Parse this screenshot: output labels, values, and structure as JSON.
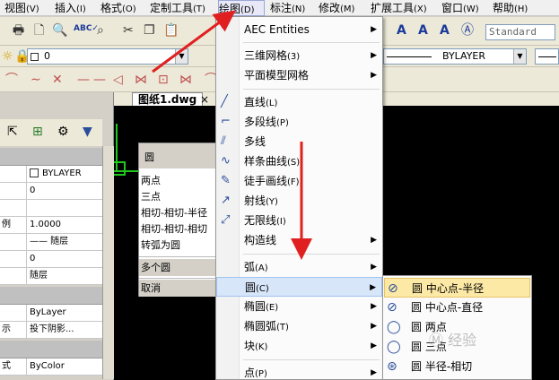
{
  "menubar": {
    "items": [
      {
        "label": "视图",
        "accel": "(V)"
      },
      {
        "label": "插入",
        "accel": "(I)"
      },
      {
        "label": "格式",
        "accel": "(O)"
      },
      {
        "label": "定制工具",
        "accel": "(T)"
      },
      {
        "label": "绘图",
        "accel": "(D)"
      },
      {
        "label": "标注",
        "accel": "(N)"
      },
      {
        "label": "修改",
        "accel": "(M)"
      },
      {
        "label": "扩展工具",
        "accel": "(X)"
      },
      {
        "label": "窗口",
        "accel": "(W)"
      },
      {
        "label": "帮助",
        "accel": "(H)"
      }
    ]
  },
  "toolbar": {
    "layer_value": "0",
    "linetype_value": "BYLAYER",
    "textstyle_value": "Standard"
  },
  "drawing_tab": {
    "filename": "图纸1.dwg",
    "close": "×"
  },
  "properties": {
    "rows": [
      {
        "label": "",
        "value": "BYLAYER"
      },
      {
        "label": "",
        "value": "0"
      },
      {
        "label": "",
        "value": ""
      },
      {
        "label": "例",
        "value": "1.0000"
      },
      {
        "label": "",
        "value": "—— 随层"
      },
      {
        "label": "",
        "value": "0"
      },
      {
        "label": "",
        "value": "随层"
      },
      {
        "label": "",
        "value": "ByLayer"
      },
      {
        "label": "示",
        "value": "投下阴影..."
      },
      {
        "label": "式",
        "value": "ByColor"
      }
    ]
  },
  "circle_panel": {
    "title": "圆",
    "items": [
      "两点",
      "三点",
      "相切-相切-半径",
      "相切-相切-相切",
      "转弧为圆",
      "多个圆",
      "取消"
    ]
  },
  "draw_menu": {
    "items": [
      {
        "label": "AEC Entities",
        "accel": "",
        "submenu": true,
        "icon": ""
      },
      {
        "label": "三维网格",
        "accel": "(3)",
        "submenu": true,
        "icon": ""
      },
      {
        "label": "平面模型网格",
        "accel": "",
        "submenu": true,
        "icon": ""
      },
      {
        "label": "直线",
        "accel": "(L)",
        "submenu": false,
        "icon": "line-icon"
      },
      {
        "label": "多段线",
        "accel": "(P)",
        "submenu": false,
        "icon": "polyline-icon"
      },
      {
        "label": "多线",
        "accel": "",
        "submenu": false,
        "icon": "multiline-icon"
      },
      {
        "label": "样条曲线",
        "accel": "(S)",
        "submenu": false,
        "icon": "spline-icon"
      },
      {
        "label": "徒手画线",
        "accel": "(F)",
        "submenu": false,
        "icon": "freehand-icon"
      },
      {
        "label": "射线",
        "accel": "(Y)",
        "submenu": false,
        "icon": "ray-icon"
      },
      {
        "label": "无限线",
        "accel": "(I)",
        "submenu": false,
        "icon": "xline-icon"
      },
      {
        "label": "构造线",
        "accel": "",
        "submenu": true,
        "icon": ""
      },
      {
        "label": "弧",
        "accel": "(A)",
        "submenu": true,
        "icon": ""
      },
      {
        "label": "圆",
        "accel": "(C)",
        "submenu": true,
        "icon": ""
      },
      {
        "label": "椭圆",
        "accel": "(E)",
        "submenu": true,
        "icon": ""
      },
      {
        "label": "椭圆弧",
        "accel": "(T)",
        "submenu": true,
        "icon": ""
      },
      {
        "label": "块",
        "accel": "(K)",
        "submenu": true,
        "icon": ""
      },
      {
        "label": "点",
        "accel": "(P)",
        "submenu": true,
        "icon": ""
      }
    ]
  },
  "circle_submenu": {
    "items": [
      {
        "label": "圆 中心点-半径",
        "icon": "circle-center-radius-icon"
      },
      {
        "label": "圆 中心点-直径",
        "icon": "circle-center-diameter-icon"
      },
      {
        "label": "圆 两点",
        "icon": "circle-2point-icon"
      },
      {
        "label": "圆 三点",
        "icon": "circle-3point-icon"
      },
      {
        "label": "圆 半径-相切",
        "icon": "circle-tan-tan-radius-icon"
      }
    ]
  },
  "watermark": "Ⓜ 经验",
  "colors": {
    "menu_highlight": "#d8e6fa",
    "submenu_highlight": "#fde9a6",
    "annotation_arrow": "#e02020",
    "canvas_bg": "#000000"
  }
}
